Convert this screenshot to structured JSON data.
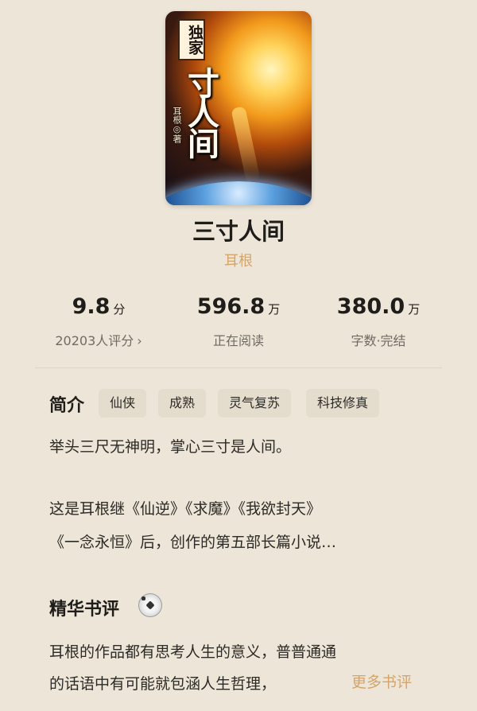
{
  "book": {
    "cover_badge": "独家",
    "cover_title": "寸人间",
    "cover_author": "耳根◎著",
    "title": "三寸人间",
    "author": "耳根"
  },
  "stats": [
    {
      "value": "9.8",
      "unit": "分",
      "label": "20203人评分",
      "chevron": "›"
    },
    {
      "value": "596.8",
      "unit": "万",
      "label": "正在阅读"
    },
    {
      "value": "380.0",
      "unit": "万",
      "label": "字数·完结"
    }
  ],
  "intro": {
    "heading": "简介",
    "tags": [
      "仙侠",
      "成熟",
      "灵气复苏",
      "科技修真"
    ],
    "line1": "举头三尺无神明，掌心三寸是人间。",
    "line2": "这是耳根继《仙逆》《求魔》《我欲封天》",
    "line3": "《一念永恒》后，创作的第五部长篇小说…"
  },
  "reviews": {
    "heading": "精华书评",
    "icon": "soccer-ball-icon",
    "line1": "耳根的作品都有思考人生的意义，普普通通",
    "line2": "的话语中有可能就包涵人生哲理，",
    "more_label": "更多书评"
  },
  "colors": {
    "background": "#ede6d8",
    "accent": "#d4a46a",
    "tag_bg": "#e4dccd"
  }
}
